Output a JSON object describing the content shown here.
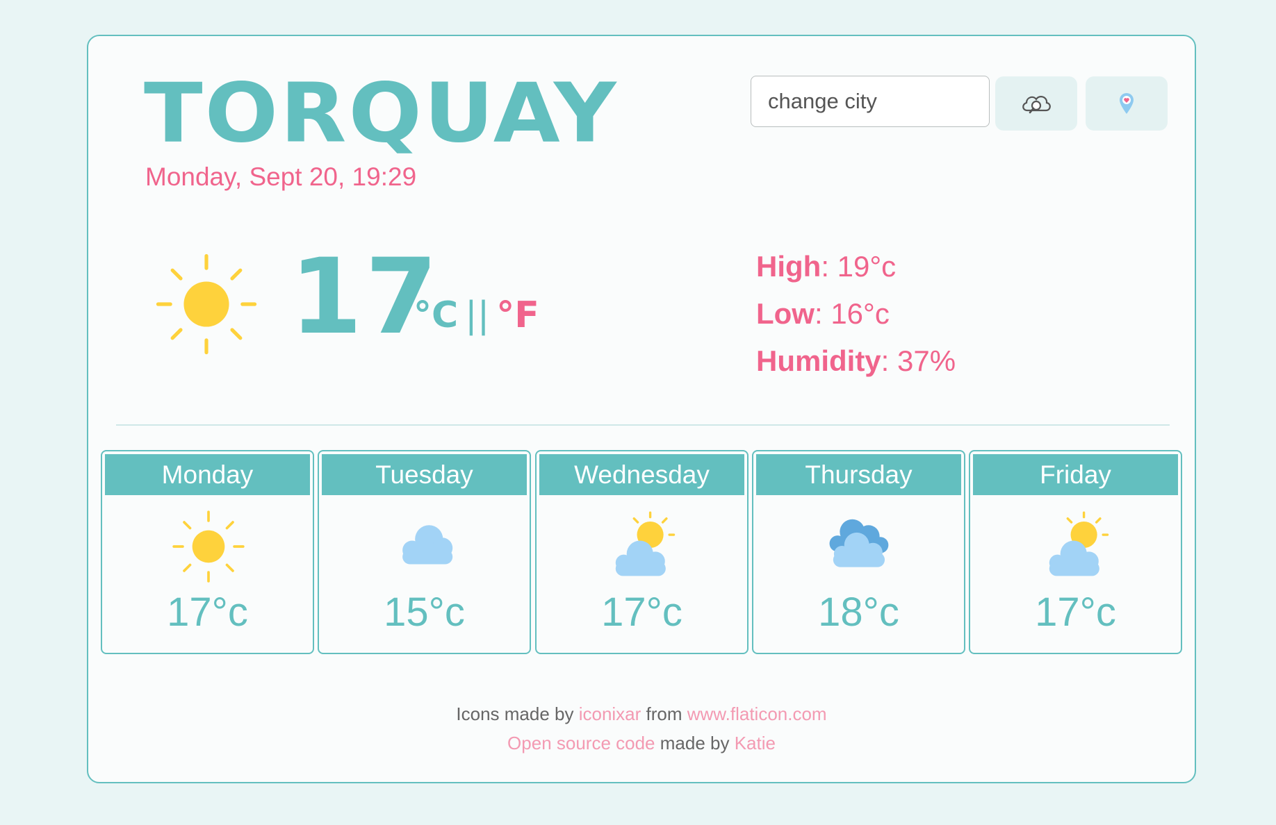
{
  "city": "TORQUAY",
  "datetime": "Monday, Sept 20, 19:29",
  "search": {
    "placeholder": "change city"
  },
  "buttons": {
    "search_icon": "cloud-search-icon",
    "location_icon": "location-pin-icon"
  },
  "current": {
    "icon": "sun-icon",
    "temperature": "17",
    "unit_c": "°C",
    "unit_sep": "||",
    "unit_f": "°F",
    "high_label": "High",
    "high_value": ": 19°c",
    "low_label": "Low",
    "low_value": ": 16°c",
    "humidity_label": "Humidity",
    "humidity_value": ": 37%"
  },
  "forecast": [
    {
      "day": "Monday",
      "temp": "17°c",
      "icon": "sun-icon"
    },
    {
      "day": "Tuesday",
      "temp": "15°c",
      "icon": "cloud-icon"
    },
    {
      "day": "Wednesday",
      "temp": "17°c",
      "icon": "partly-cloudy-icon"
    },
    {
      "day": "Thursday",
      "temp": "18°c",
      "icon": "cloudy-icon"
    },
    {
      "day": "Friday",
      "temp": "17°c",
      "icon": "partly-cloudy-icon"
    }
  ],
  "footer": {
    "line1_pre": "Icons made by ",
    "line1_author": "iconixar",
    "line1_mid": " from ",
    "line1_site": "www.flaticon.com",
    "line2_link": "Open source code",
    "line2_mid": " made by ",
    "line2_author": "Katie"
  },
  "colors": {
    "accent": "#63bfbf",
    "pink": "#f0648c",
    "sun": "#fed23c",
    "cloud": "#a2d3f6",
    "cloud_dark": "#5fa8dd"
  }
}
